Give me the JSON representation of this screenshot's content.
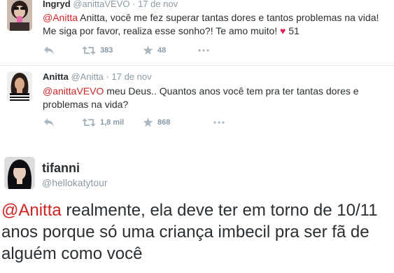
{
  "tweets": [
    {
      "fullname": "Ingryd",
      "handle": "@anittaVEVO",
      "separator": "·",
      "time": "17 de nov",
      "mention": "@Anitta",
      "text": " Anitta, você me fez superar tantas dores e tantos problemas na vida! Me siga por favor, realiza esse sonho?! Te amo muito! ",
      "heart": "♥",
      "text_after": " 51",
      "retweets": "383",
      "favorites": "48"
    },
    {
      "fullname": "Anitta",
      "handle": "@Anitta",
      "separator": "·",
      "time": "17 de nov",
      "mention": "@anittaVEVO",
      "text": " meu Deus.. Quantos anos você tem pra ter tantas dores e problemas na vida?",
      "retweets": "1,8 mil",
      "favorites": "868"
    }
  ],
  "main_tweet": {
    "fullname": "tifanni",
    "handle": "@hellokatytour",
    "mention": "@Anitta",
    "text": " realmente, ela deve ter em torno de 10/11 anos porque só uma criança imbecil pra ser fã de alguém como você"
  },
  "icons": [
    "reply-icon",
    "retweet-icon",
    "favorite-icon",
    "more-icon"
  ],
  "colors": {
    "mention": "#ce2424",
    "meta": "#8899a6",
    "text": "#292f33",
    "heart": "#e0245e"
  }
}
